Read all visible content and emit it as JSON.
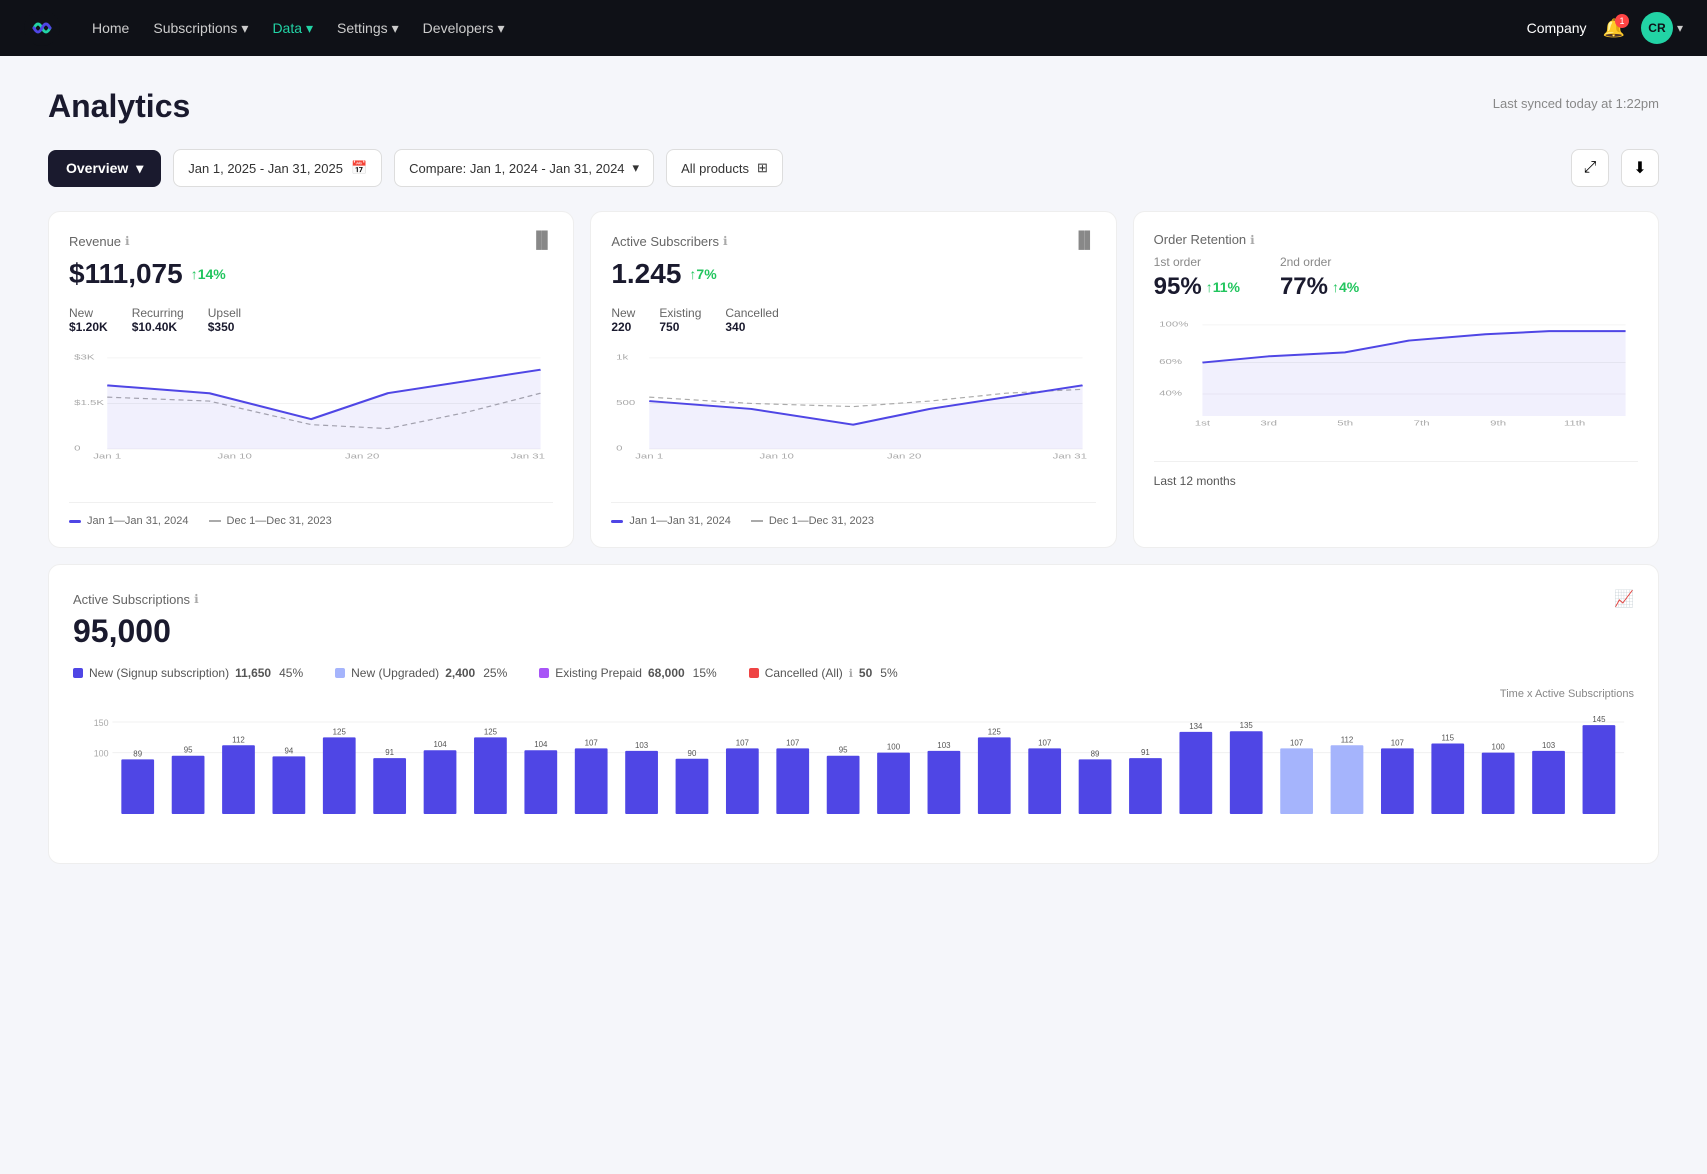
{
  "nav": {
    "logo_alt": "Loop logo",
    "links": [
      {
        "label": "Home",
        "active": false
      },
      {
        "label": "Subscriptions",
        "active": false,
        "dropdown": true
      },
      {
        "label": "Data",
        "active": true,
        "dropdown": true
      },
      {
        "label": "Settings",
        "active": false,
        "dropdown": true
      },
      {
        "label": "Developers",
        "active": false,
        "dropdown": true
      }
    ],
    "company": "Company",
    "notification_count": "1",
    "avatar": "CR"
  },
  "page": {
    "title": "Analytics",
    "sync_text": "Last synced today at 1:22pm"
  },
  "toolbar": {
    "overview_label": "Overview",
    "date_range": "Jan 1, 2025 - Jan 31, 2025",
    "compare": "Compare: Jan 1, 2024 - Jan 31, 2024",
    "products": "All products"
  },
  "revenue_card": {
    "title": "Revenue",
    "value": "$111,075",
    "trend": "↑14%",
    "new_label": "New",
    "new_value": "$1.20K",
    "recurring_label": "Recurring",
    "recurring_value": "$10.40K",
    "upsell_label": "Upsell",
    "upsell_value": "$350",
    "y_labels": [
      "$3K",
      "$1.5K",
      "0"
    ],
    "x_labels": [
      "Jan 1",
      "Jan 10",
      "Jan 20",
      "Jan 31"
    ],
    "legend1": "Jan 1—Jan 31, 2024",
    "legend2": "Dec 1—Dec 31, 2023"
  },
  "subscribers_card": {
    "title": "Active Subscribers",
    "value": "1.245",
    "trend": "↑7%",
    "new_label": "New",
    "new_value": "220",
    "existing_label": "Existing",
    "existing_value": "750",
    "cancelled_label": "Cancelled",
    "cancelled_value": "340",
    "y_labels": [
      "1k",
      "500",
      "0"
    ],
    "x_labels": [
      "Jan 1",
      "Jan 10",
      "Jan 20",
      "Jan 31"
    ],
    "legend1": "Jan 1—Jan 31, 2024",
    "legend2": "Dec 1—Dec 31, 2023"
  },
  "retention_card": {
    "title": "Order Retention",
    "first_order_label": "1st order",
    "first_order_value": "95%",
    "first_order_trend": "↑11%",
    "second_order_label": "2nd order",
    "second_order_value": "77%",
    "second_order_trend": "↑4%",
    "y_labels": [
      "100%",
      "60%",
      "40%"
    ],
    "x_labels": [
      "1st",
      "3rd",
      "5th",
      "7th",
      "9th",
      "11th"
    ],
    "legend": "Last 12 months"
  },
  "active_subs": {
    "title": "Active Subscriptions",
    "value": "95,000",
    "legend": [
      {
        "label": "New (Signup subscription)",
        "color": "#4f46e5",
        "count": "11,650",
        "pct": "45%"
      },
      {
        "label": "New (Upgraded)",
        "color": "#a5b4fc",
        "count": "2,400",
        "pct": "25%"
      },
      {
        "label": "Existing Prepaid",
        "color": "#a855f7",
        "count": "68,000",
        "pct": "15%"
      },
      {
        "label": "Cancelled (All)",
        "color": "#ef4444",
        "count": "50",
        "pct": "5%"
      }
    ],
    "chart_label": "Time x Active Subscriptions",
    "y_labels": [
      "150",
      "100"
    ],
    "bars": [
      {
        "val": 89,
        "color": "#4f46e5"
      },
      {
        "val": 95,
        "color": "#4f46e5"
      },
      {
        "val": 112,
        "color": "#4f46e5"
      },
      {
        "val": 94,
        "color": "#4f46e5"
      },
      {
        "val": 125,
        "color": "#4f46e5"
      },
      {
        "val": 91,
        "color": "#4f46e5"
      },
      {
        "val": 104,
        "color": "#4f46e5"
      },
      {
        "val": 125,
        "color": "#4f46e5"
      },
      {
        "val": 104,
        "color": "#4f46e5"
      },
      {
        "val": 107,
        "color": "#4f46e5"
      },
      {
        "val": 103,
        "color": "#4f46e5"
      },
      {
        "val": 90,
        "color": "#4f46e5"
      },
      {
        "val": 107,
        "color": "#4f46e5"
      },
      {
        "val": 107,
        "color": "#4f46e5"
      },
      {
        "val": 95,
        "color": "#4f46e5"
      },
      {
        "val": 100,
        "color": "#4f46e5"
      },
      {
        "val": 103,
        "color": "#4f46e5"
      },
      {
        "val": 125,
        "color": "#4f46e5"
      },
      {
        "val": 107,
        "color": "#4f46e5"
      },
      {
        "val": 89,
        "color": "#4f46e5"
      },
      {
        "val": 91,
        "color": "#4f46e5"
      },
      {
        "val": 134,
        "color": "#4f46e5"
      },
      {
        "val": 135,
        "color": "#4f46e5"
      },
      {
        "val": 107,
        "color": "#a5b4fc"
      },
      {
        "val": 112,
        "color": "#a5b4fc"
      },
      {
        "val": 107,
        "color": "#4f46e5"
      },
      {
        "val": 115,
        "color": "#4f46e5"
      },
      {
        "val": 100,
        "color": "#4f46e5"
      },
      {
        "val": 103,
        "color": "#4f46e5"
      },
      {
        "val": 145,
        "color": "#4f46e5"
      }
    ]
  }
}
